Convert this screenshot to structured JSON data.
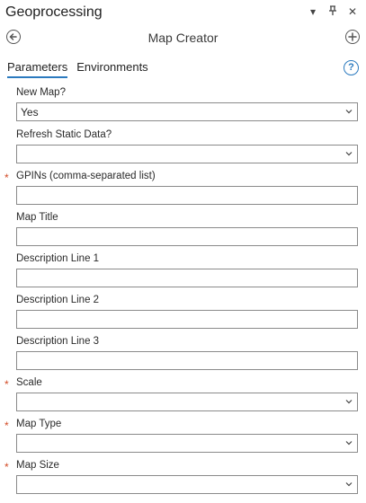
{
  "window": {
    "title": "Geoprocessing",
    "controls": {
      "options_icon": "▾",
      "pin_icon": "pin-icon",
      "close_icon": "✕"
    }
  },
  "tool": {
    "title": "Map Creator"
  },
  "tabs": [
    {
      "label": "Parameters",
      "active": true
    },
    {
      "label": "Environments",
      "active": false
    }
  ],
  "help": {
    "glyph": "?"
  },
  "params": [
    {
      "label": "New Map?",
      "value": "Yes",
      "type": "dropdown",
      "required": false
    },
    {
      "label": "Refresh Static Data?",
      "value": "",
      "type": "dropdown",
      "required": false
    },
    {
      "label": "GPINs (comma-separated list)",
      "value": "",
      "type": "text",
      "required": true
    },
    {
      "label": "Map Title",
      "value": "",
      "type": "text",
      "required": false
    },
    {
      "label": "Description Line 1",
      "value": "",
      "type": "text",
      "required": false
    },
    {
      "label": "Description Line 2",
      "value": "",
      "type": "text",
      "required": false
    },
    {
      "label": "Description Line 3",
      "value": "",
      "type": "text",
      "required": false
    },
    {
      "label": "Scale",
      "value": "",
      "type": "dropdown",
      "required": true
    },
    {
      "label": "Map Type",
      "value": "",
      "type": "dropdown",
      "required": true
    },
    {
      "label": "Map Size",
      "value": "",
      "type": "dropdown",
      "required": true
    }
  ],
  "required_marker": "*",
  "colors": {
    "accent": "#2b7abf",
    "required": "#d24b26"
  }
}
